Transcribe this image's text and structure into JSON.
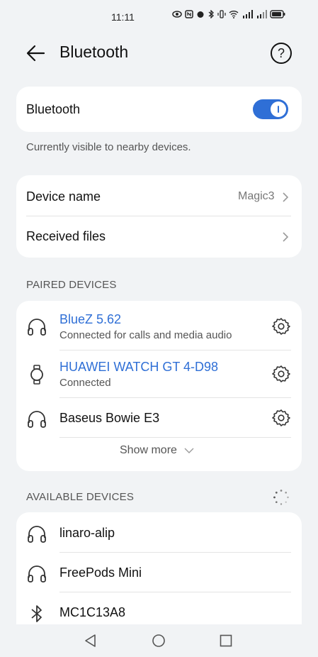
{
  "status_bar": {
    "time": "11:11"
  },
  "header": {
    "title": "Bluetooth",
    "help_label": "?"
  },
  "bluetooth_card": {
    "label": "Bluetooth",
    "enabled": true
  },
  "visibility_note": "Currently visible to nearby devices.",
  "device_card": {
    "device_name_label": "Device name",
    "device_name_value": "Magic3",
    "received_files_label": "Received files"
  },
  "paired": {
    "section_title": "PAIRED DEVICES",
    "devices": [
      {
        "name": "BlueZ 5.62",
        "status": "Connected for calls and media audio",
        "icon": "headphones-icon",
        "connected": true
      },
      {
        "name": "HUAWEI WATCH GT 4-D98",
        "status": "Connected",
        "icon": "watch-icon",
        "connected": true
      },
      {
        "name": "Baseus Bowie E3",
        "status": "",
        "icon": "headphones-icon",
        "connected": false
      }
    ],
    "show_more": "Show more"
  },
  "available": {
    "section_title": "AVAILABLE DEVICES",
    "devices": [
      {
        "name": "linaro-alip",
        "icon": "headphones-icon"
      },
      {
        "name": "FreePods Mini",
        "icon": "headphones-icon"
      },
      {
        "name": "MC1C13A8",
        "icon": "bluetooth-icon"
      }
    ]
  },
  "colors": {
    "accent": "#2f6fd6",
    "background": "#f1f3f5",
    "card": "#ffffff"
  }
}
